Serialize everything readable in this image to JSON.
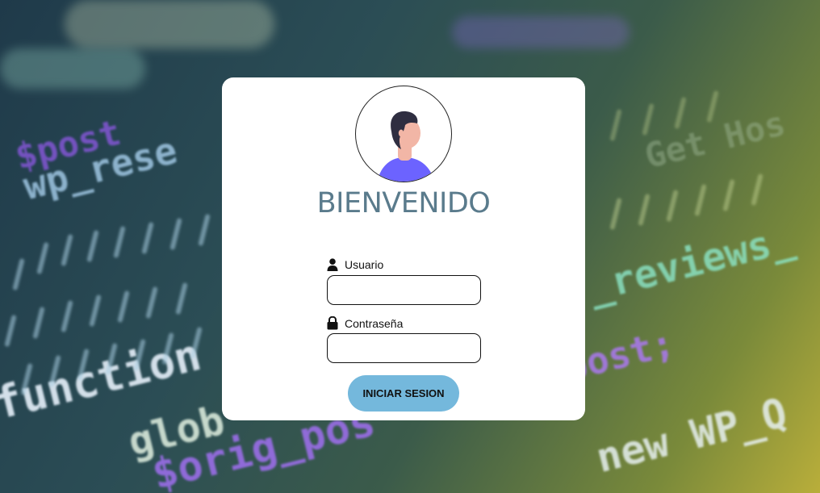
{
  "login": {
    "title": "BIENVENIDO",
    "username": {
      "label": "Usuario",
      "value": "",
      "placeholder": ""
    },
    "password": {
      "label": "Contraseña",
      "value": "",
      "placeholder": ""
    },
    "submit_label": "INICIAR SESION"
  },
  "background": {
    "code_fragments": [
      "wp_rese",
      "function",
      "glob",
      "$orig_pos",
      "new WP_Q",
      "_reviews_",
      "post;",
      "Get Hos",
      "$post"
    ]
  },
  "icons": {
    "avatar": "user-avatar-illustration",
    "username": "person-icon",
    "password": "lock-icon"
  },
  "colors": {
    "title": "#5a7b8c",
    "button": "#74b8dc",
    "card": "#ffffff",
    "avatar_shirt": "#6c63ff"
  }
}
